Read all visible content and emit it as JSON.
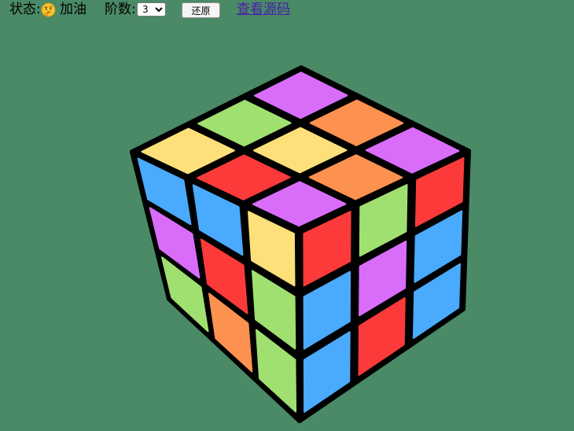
{
  "toolbar": {
    "status_label": "状态:",
    "status_emoji_icon": "thinking-face-icon",
    "status_text": "加油",
    "order_label": "阶数:",
    "order_select": {
      "selected": "3"
    },
    "restore_label": "还原",
    "source_link_label": "查看源码"
  },
  "colors": {
    "background": "#4a8a66",
    "border": "#000000",
    "yellow": "#fde07a",
    "red": "#fd3a3a",
    "blue": "#4aaafd",
    "green": "#a0e070",
    "purple": "#d96dfa",
    "orange": "#fd9150",
    "link": "#4a20a8"
  },
  "cube": {
    "order": 3,
    "faces": {
      "top": [
        [
          "purple",
          "orange",
          "purple"
        ],
        [
          "green",
          "yellow",
          "orange"
        ],
        [
          "yellow",
          "red",
          "purple"
        ]
      ],
      "left": [
        [
          "blue",
          "blue",
          "yellow"
        ],
        [
          "purple",
          "red",
          "green"
        ],
        [
          "green",
          "orange",
          "green"
        ]
      ],
      "right": [
        [
          "red",
          "green",
          "red"
        ],
        [
          "blue",
          "purple",
          "blue"
        ],
        [
          "blue",
          "red",
          "blue"
        ]
      ]
    }
  }
}
